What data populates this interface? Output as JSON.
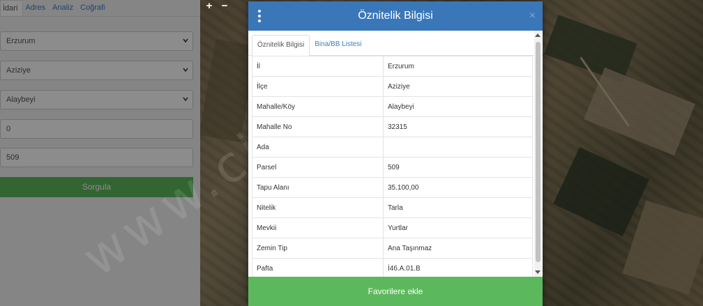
{
  "left_panel": {
    "tabs": [
      {
        "label": "İdari",
        "active": true
      },
      {
        "label": "Adres",
        "active": false
      },
      {
        "label": "Analiz",
        "active": false
      },
      {
        "label": "Coğrafi",
        "active": false
      }
    ],
    "fields": {
      "il": "Erzurum",
      "ilce": "Aziziye",
      "mahalle": "Alaybeyi",
      "ada": "0",
      "parsel": "509"
    },
    "query_button": "Sorgula"
  },
  "map": {
    "zoom_in": "+",
    "zoom_out": "−",
    "watermark": "www.ci"
  },
  "modal": {
    "title": "Öznitelik Bilgisi",
    "close": "×",
    "tabs": [
      {
        "label": "Öznitelik Bilgisi",
        "active": true
      },
      {
        "label": "Bina/BB Listesi",
        "active": false
      }
    ],
    "rows": [
      {
        "key": "İl",
        "value": "Erzurum"
      },
      {
        "key": "İlçe",
        "value": "Aziziye"
      },
      {
        "key": "Mahalle/Köy",
        "value": "Alaybeyi"
      },
      {
        "key": "Mahalle No",
        "value": "32315"
      },
      {
        "key": "Ada",
        "value": ""
      },
      {
        "key": "Parsel",
        "value": "509"
      },
      {
        "key": "Tapu Alanı",
        "value": "35.100,00"
      },
      {
        "key": "Nitelik",
        "value": "Tarla"
      },
      {
        "key": "Mevkii",
        "value": "Yurtlar"
      },
      {
        "key": "Zemin Tip",
        "value": "Ana Taşınmaz"
      },
      {
        "key": "Pafta",
        "value": "İ46.A.01.B"
      }
    ],
    "favorite_button": "Favorilere ekle"
  },
  "colors": {
    "header_blue": "#3a77b9",
    "button_green": "#5cb85c",
    "link_blue": "#3c7bc0"
  }
}
